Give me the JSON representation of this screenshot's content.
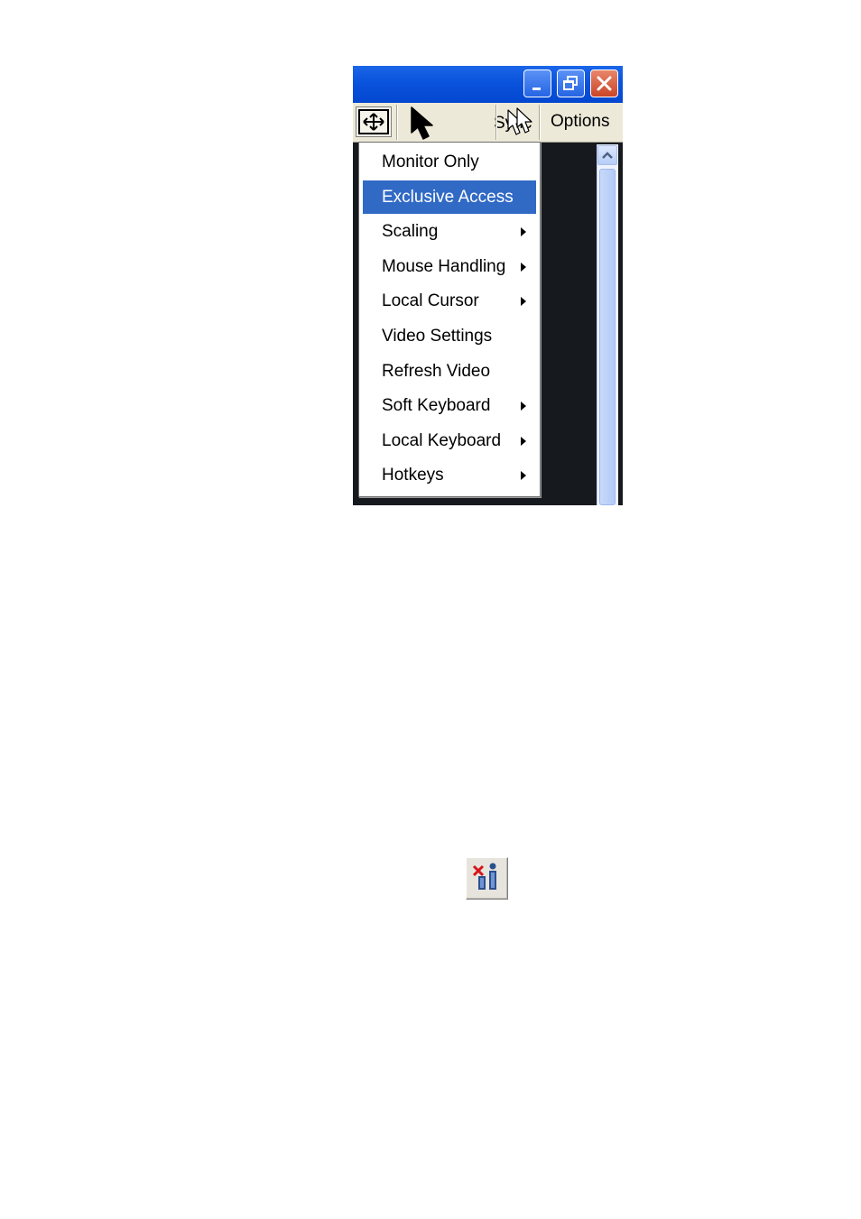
{
  "window": {
    "titlebar": {
      "minimize_icon": "minimize-icon",
      "restore_icon": "restore-icon",
      "close_icon": "close-icon"
    },
    "toolbar": {
      "fit_icon": "fit-window-icon",
      "sync_icon": "pointer-icon",
      "sync_label": "Sync",
      "cursor_icon": "outline-pointer-icon",
      "options_label": "Options"
    },
    "scrollbar": {
      "up_icon": "chevron-up-icon"
    }
  },
  "menu": {
    "items": [
      {
        "label": "Monitor Only",
        "submenu": false,
        "selected": false
      },
      {
        "label": "Exclusive Access",
        "submenu": false,
        "selected": true
      },
      {
        "label": "Scaling",
        "submenu": true,
        "selected": false
      },
      {
        "label": "Mouse Handling",
        "submenu": true,
        "selected": false
      },
      {
        "label": "Local Cursor",
        "submenu": true,
        "selected": false
      },
      {
        "label": "Video Settings",
        "submenu": false,
        "selected": false
      },
      {
        "label": "Refresh Video",
        "submenu": false,
        "selected": false
      },
      {
        "label": "Soft Keyboard",
        "submenu": true,
        "selected": false
      },
      {
        "label": "Local Keyboard",
        "submenu": true,
        "selected": false
      },
      {
        "label": "Hotkeys",
        "submenu": true,
        "selected": false
      }
    ],
    "selected_color": "#316ac5"
  },
  "lone_icon": {
    "icon": "network-disconnect-icon"
  },
  "colors": {
    "titlebar_blue": "#0a53dc",
    "close_red": "#c94528",
    "toolbar_bg": "#ece9d8",
    "remote_screen": "#16191d"
  }
}
